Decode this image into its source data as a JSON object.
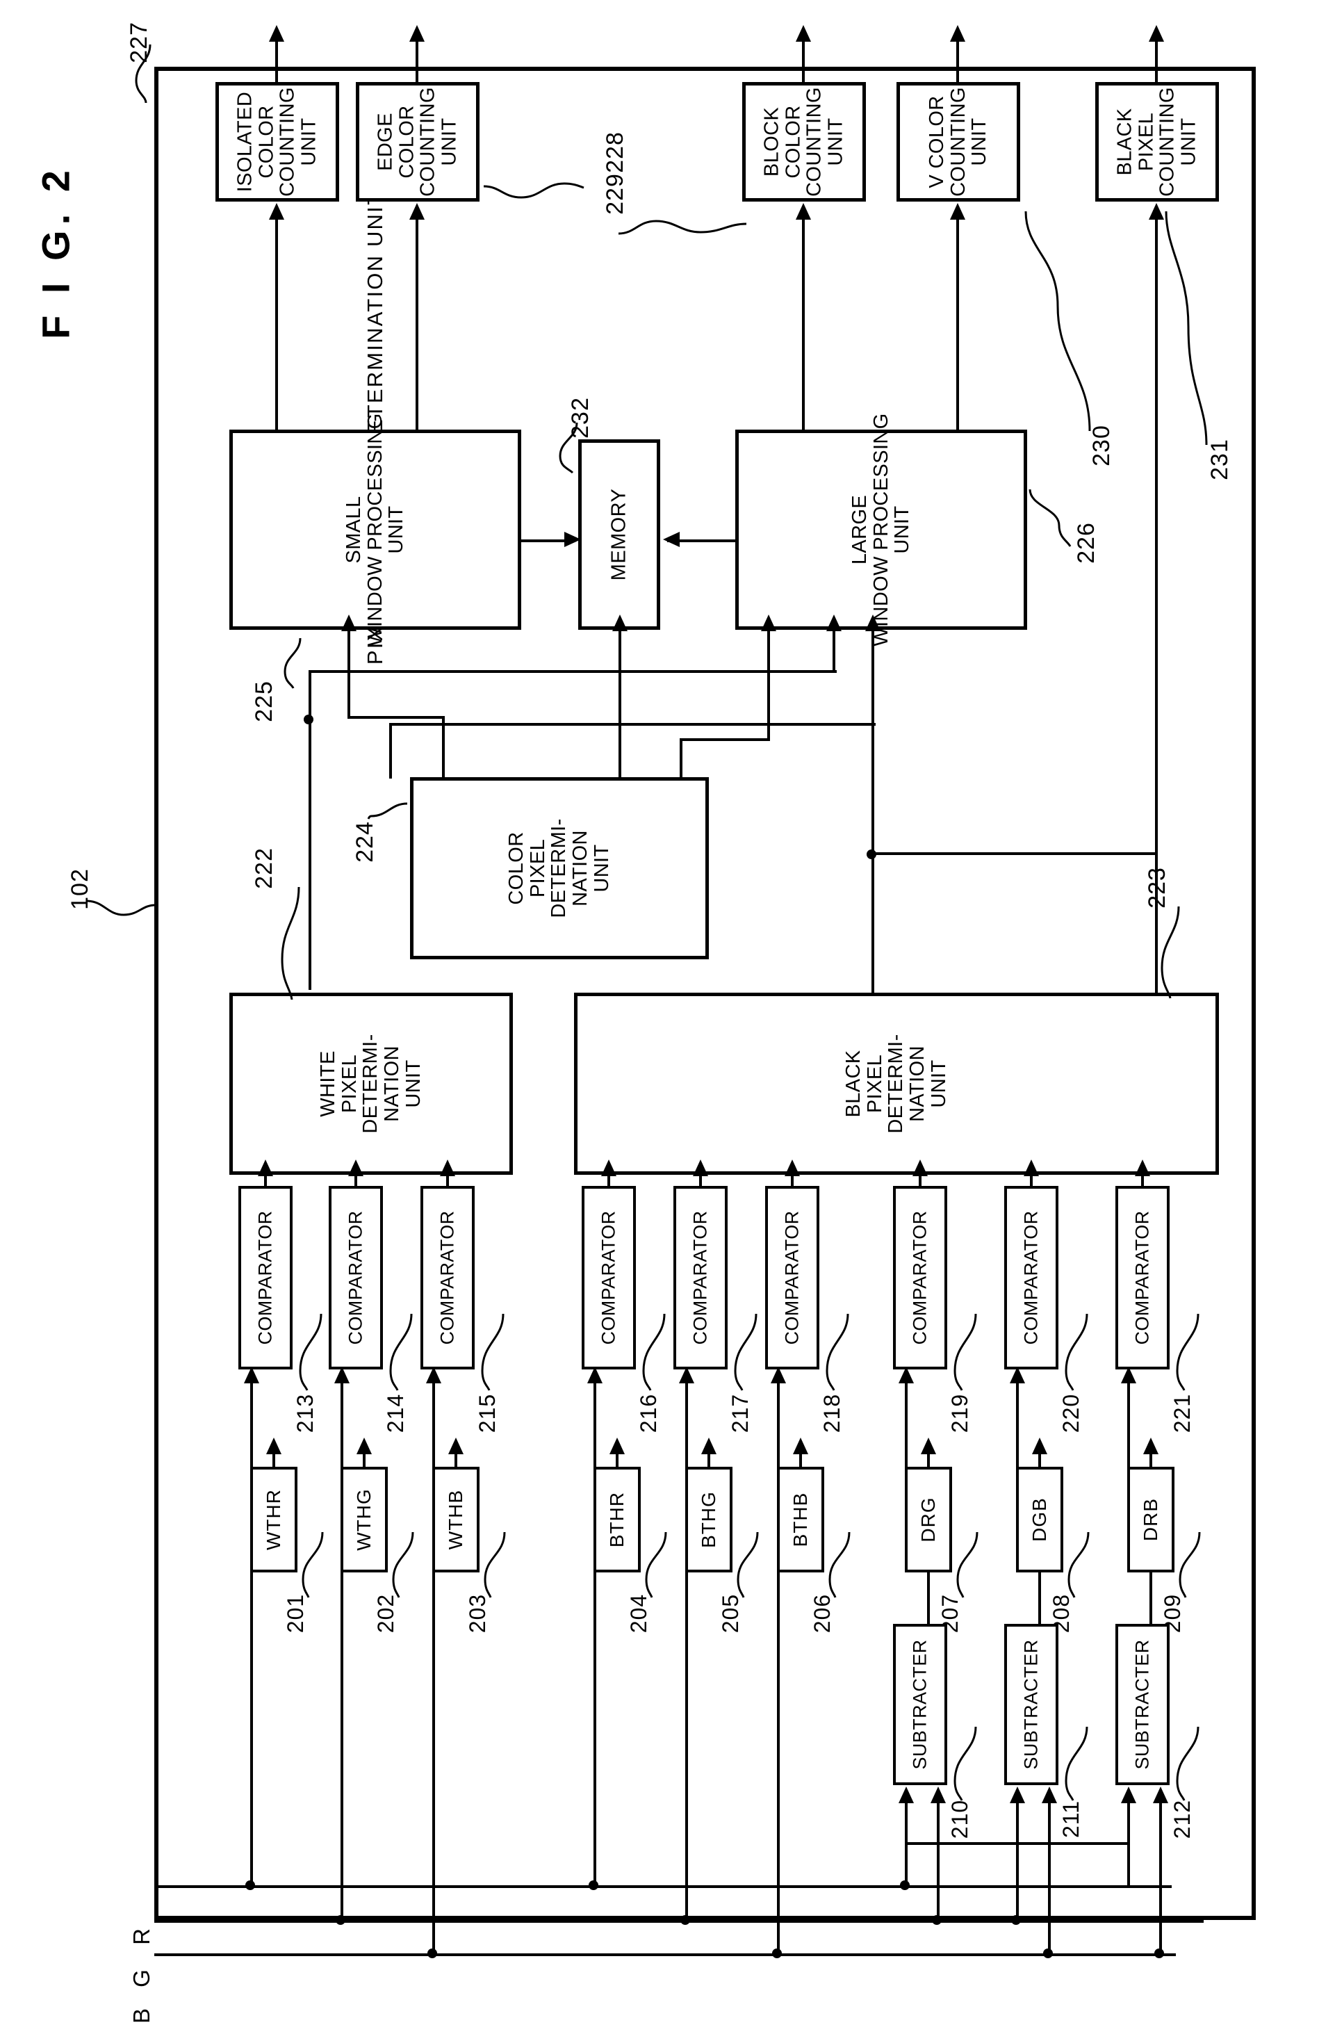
{
  "figure": {
    "title": "F I G.  2",
    "frame_label": "PIXEL ATTRIBUTE DETERMINATION UNIT",
    "frame_ref": "102"
  },
  "inputs": [
    {
      "name": "R"
    },
    {
      "name": "G"
    },
    {
      "name": "B"
    }
  ],
  "thresholds": [
    {
      "label": "WTHR",
      "ref": "201"
    },
    {
      "label": "WTHG",
      "ref": "202"
    },
    {
      "label": "WTHB",
      "ref": "203"
    },
    {
      "label": "BTHR",
      "ref": "204"
    },
    {
      "label": "BTHG",
      "ref": "205"
    },
    {
      "label": "BTHB",
      "ref": "206"
    },
    {
      "label": "DRG",
      "ref": "207"
    },
    {
      "label": "DGB",
      "ref": "208"
    },
    {
      "label": "DRB",
      "ref": "209"
    }
  ],
  "subtracters": [
    {
      "label": "SUBTRACTER",
      "ref": "210"
    },
    {
      "label": "SUBTRACTER",
      "ref": "211"
    },
    {
      "label": "SUBTRACTER",
      "ref": "212"
    }
  ],
  "comparators": [
    {
      "label": "COMPARATOR",
      "ref": "213"
    },
    {
      "label": "COMPARATOR",
      "ref": "214"
    },
    {
      "label": "COMPARATOR",
      "ref": "215"
    },
    {
      "label": "COMPARATOR",
      "ref": "216"
    },
    {
      "label": "COMPARATOR",
      "ref": "217"
    },
    {
      "label": "COMPARATOR",
      "ref": "218"
    },
    {
      "label": "COMPARATOR",
      "ref": "219"
    },
    {
      "label": "COMPARATOR",
      "ref": "220"
    },
    {
      "label": "COMPARATOR",
      "ref": "221"
    }
  ],
  "determination_units": [
    {
      "label": "WHITE\nPIXEL\nDETERMI-\nNATION\nUNIT",
      "ref": "222"
    },
    {
      "label": "BLACK\nPIXEL\nDETERMI-\nNATION\nUNIT",
      "ref": "223"
    },
    {
      "label": "COLOR\nPIXEL\nDETERMI-\nNATION\nUNIT",
      "ref": "224"
    }
  ],
  "processing_units": [
    {
      "label": "SMALL\nWINDOW\nPROCESSING\nUNIT",
      "ref": "225"
    },
    {
      "label": "LARGE\nWINDOW\nPROCESSING\nUNIT",
      "ref": "226"
    },
    {
      "label": "MEMORY",
      "ref": "232"
    }
  ],
  "counting_units": [
    {
      "label": "ISOLATED\nCOLOR\nCOUNTING\nUNIT",
      "ref": "227"
    },
    {
      "label": "EDGE\nCOLOR\nCOUNTING\nUNIT",
      "ref": "228"
    },
    {
      "label": "BLOCK\nCOLOR\nCOUNTING\nUNIT",
      "ref": "229"
    },
    {
      "label": "V COLOR\nCOUNTING\nUNIT",
      "ref": "230"
    },
    {
      "label": "BLACK\nPIXEL\nCOUNTING\nUNIT",
      "ref": "231"
    }
  ],
  "extra_refs": [
    "229"
  ]
}
